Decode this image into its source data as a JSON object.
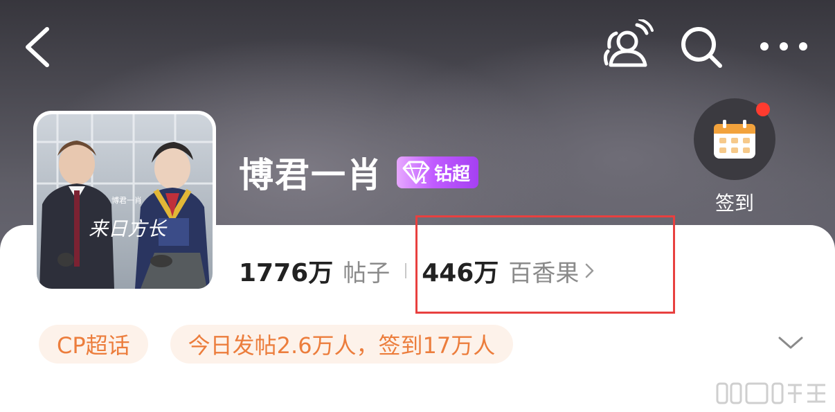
{
  "topic": {
    "title": "博君一肖",
    "rank_badge": "钻超",
    "avatar_overlay_text": "来日方长"
  },
  "stats": {
    "posts_count": "1776万",
    "posts_label": "帖子",
    "fans_count": "446万",
    "fans_label": "百香果"
  },
  "checkin": {
    "label": "签到"
  },
  "tags": [
    {
      "label": "CP超话"
    },
    {
      "label": "今日发帖2.6万人，签到17万人"
    }
  ],
  "icons": {
    "back": "back-chevron-icon",
    "friends": "friends-icon",
    "search": "search-icon",
    "more": "more-icon",
    "checkin": "calendar-icon",
    "expand": "chevron-down-icon",
    "fans_arrow": "chevron-right-icon"
  },
  "colors": {
    "tag_background": "#fdf2ea",
    "tag_text": "#ec7d3c",
    "badge_purple": "#b04cf5",
    "notification_dot": "#ff3b2f",
    "highlight_border": "#e8403f"
  },
  "watermark": "微博"
}
